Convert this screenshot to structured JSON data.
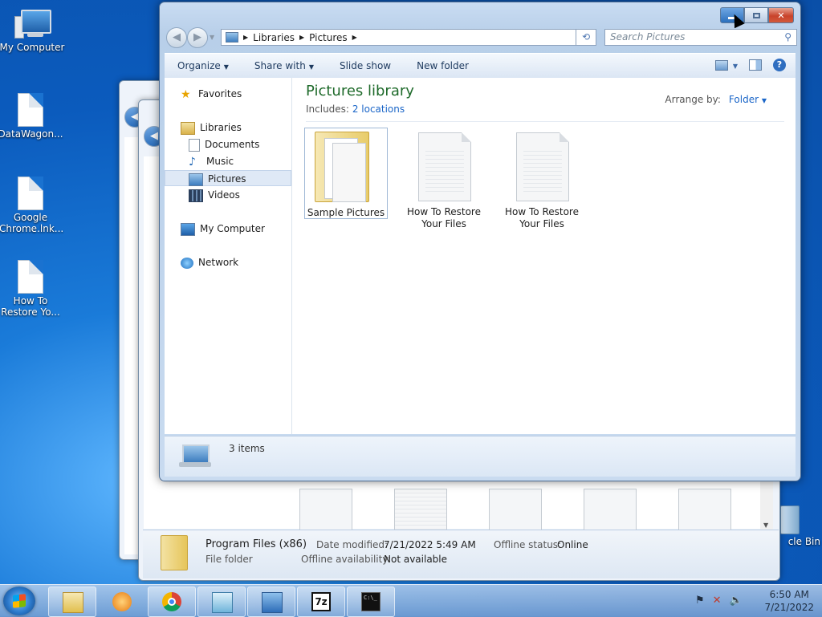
{
  "desktop": {
    "icons": [
      {
        "label": "My Computer"
      },
      {
        "label": "DataWagon..."
      },
      {
        "label": "Google Chrome.lnk..."
      },
      {
        "label": "How To Restore Yo..."
      },
      {
        "label": "cle Bin"
      }
    ]
  },
  "window": {
    "address": [
      "Libraries",
      "Pictures"
    ],
    "search_placeholder": "Search Pictures",
    "toolbar": {
      "organize": "Organize",
      "share_with": "Share with",
      "slide_show": "Slide show",
      "new_folder": "New folder"
    },
    "nav": {
      "favorites": "Favorites",
      "libraries": "Libraries",
      "documents": "Documents",
      "music": "Music",
      "pictures": "Pictures",
      "videos": "Videos",
      "my_computer": "My Computer",
      "network": "Network"
    },
    "library": {
      "title": "Pictures library",
      "includes_label": "Includes:",
      "includes_link": "2 locations",
      "arrange_label": "Arrange by:",
      "arrange_value": "Folder"
    },
    "items": [
      {
        "name": "Sample Pictures",
        "type": "folder"
      },
      {
        "name": "How To Restore Your Files",
        "type": "document"
      },
      {
        "name": "How To Restore Your Files",
        "type": "document"
      }
    ],
    "status": "3 items"
  },
  "background_details": {
    "name": "Program Files (x86)",
    "type": "File folder",
    "date_label": "Date modified:",
    "date_value": "7/21/2022 5:49 AM",
    "offline_status_label": "Offline status:",
    "offline_status_value": "Online",
    "offline_avail_label": "Offline availability:",
    "offline_avail_value": "Not available"
  },
  "taskbar": {
    "time": "6:50 AM",
    "date": "7/21/2022",
    "app_7z": "7z",
    "app_cmd": "C:\\_"
  }
}
